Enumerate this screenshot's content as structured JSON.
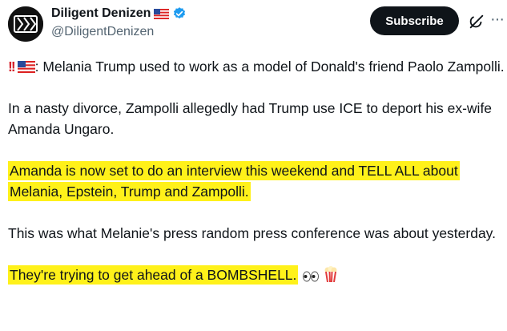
{
  "author": {
    "display_name": "Diligent Denizen",
    "handle": "@DiligentDenizen"
  },
  "actions": {
    "subscribe_label": "Subscribe"
  },
  "tweet": {
    "p1_prefix": ": Melania Trump used to work as a model of Donald's friend Paolo Zampolli.",
    "p2": "In a nasty divorce, Zampolli allegedly had Trump use ICE to deport his ex-wife Amanda Ungaro.",
    "p3": "Amanda is now set to do an interview this weekend and TELL ALL about Melania, Epstein, Trump and Zampolli.",
    "p4": "This was what Melanie's press random press conference was about yesterday.",
    "p5": "They're trying to get ahead of a BOMBSHELL."
  },
  "colors": {
    "highlight": "#fff11a",
    "verified": "#1d9bf0",
    "subscribe_bg": "#0f1419"
  },
  "icons": [
    "double-exclamation-icon",
    "us-flag-icon",
    "verified-badge-icon",
    "grok-icon",
    "more-icon",
    "eyes-icon",
    "popcorn-icon"
  ]
}
